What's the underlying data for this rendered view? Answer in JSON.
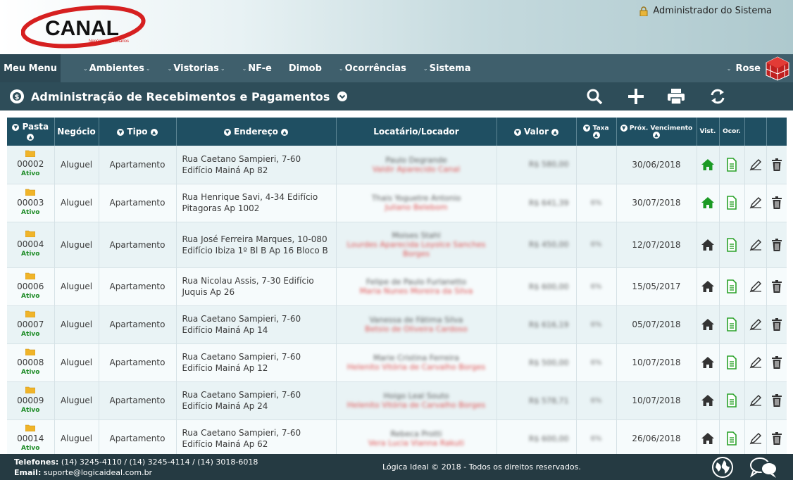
{
  "header": {
    "logo_text": "CANAL",
    "logo_subtitle": "Negócios Imobiliários",
    "admin_label": "Administrador do Sistema"
  },
  "nav": {
    "menu_label": "Meu Menu",
    "items": [
      {
        "label": "Ambientes"
      },
      {
        "label": "Vistorias"
      },
      {
        "label": "NF-e"
      },
      {
        "label": "Dimob"
      },
      {
        "label": "Ocorrências"
      },
      {
        "label": "Sistema"
      }
    ],
    "user_label": "Rose"
  },
  "page": {
    "title": "Administração de Recebimentos e Pagamentos"
  },
  "table": {
    "headers": {
      "pasta": "Pasta",
      "negocio": "Negócio",
      "tipo": "Tipo",
      "endereco": "Endereço",
      "locatario": "Locatário/Locador",
      "valor": "Valor",
      "taxa": "Taxa",
      "vencimento": "Próx. Vencimento",
      "vist": "Vist.",
      "ocor": "Ocor."
    },
    "rows": [
      {
        "pasta": "00002",
        "status": "Ativo",
        "negocio": "Aluguel",
        "tipo": "Apartamento",
        "endereco": "Rua Caetano Sampieri, 7-60 Edifício Mainá Ap 82",
        "locatario": "Paulo Degrande",
        "locador": "Valdir Aparecido Canal",
        "valor": "R$ 580,00",
        "taxa": "",
        "vencimento": "30/06/2018",
        "vist_active": true
      },
      {
        "pasta": "00003",
        "status": "Ativo",
        "negocio": "Aluguel",
        "tipo": "Apartamento",
        "endereco": "Rua Henrique Savi, 4-34 Edifício Pitagoras Ap 1002",
        "locatario": "Thais Yoguetre Antonio",
        "locador": "Juliano Belebom",
        "valor": "R$ 641,39",
        "taxa": "6%",
        "vencimento": "30/07/2018",
        "vist_active": true
      },
      {
        "pasta": "00004",
        "status": "Ativo",
        "negocio": "Aluguel",
        "tipo": "Apartamento",
        "endereco": "Rua José Ferreira Marques, 10-080 Edifício Ibiza 1º Bl B Ap 16 Bloco B",
        "locatario": "Moises Stahl",
        "locador": "Lourdes Aparecida Loyolce Sanches Borges",
        "valor": "R$ 450,00",
        "taxa": "6%",
        "vencimento": "12/07/2018",
        "vist_active": false
      },
      {
        "pasta": "00006",
        "status": "Ativo",
        "negocio": "Aluguel",
        "tipo": "Apartamento",
        "endereco": "Rua Nicolau Assis, 7-30 Edifício Juquis Ap 26",
        "locatario": "Felipe de Paulo Furlanetto",
        "locador": "Maria Nunes Moreira da Silva",
        "valor": "R$ 600,00",
        "taxa": "6%",
        "vencimento": "15/05/2017",
        "vist_active": false
      },
      {
        "pasta": "00007",
        "status": "Ativo",
        "negocio": "Aluguel",
        "tipo": "Apartamento",
        "endereco": "Rua Caetano Sampieri, 7-60 Edifício Mainá Ap 14",
        "locatario": "Vanessa de Fátima Silva",
        "locador": "Betsio de Oliveira Cardoso",
        "valor": "R$ 616,19",
        "taxa": "6%",
        "vencimento": "05/07/2018",
        "vist_active": false
      },
      {
        "pasta": "00008",
        "status": "Ativo",
        "negocio": "Aluguel",
        "tipo": "Apartamento",
        "endereco": "Rua Caetano Sampieri, 7-60 Edifício Mainá Ap 12",
        "locatario": "Marie Cristina Ferreira",
        "locador": "Helenito Vitória de Carvalho Borges",
        "valor": "R$ 500,00",
        "taxa": "6%",
        "vencimento": "10/07/2018",
        "vist_active": false
      },
      {
        "pasta": "00009",
        "status": "Ativo",
        "negocio": "Aluguel",
        "tipo": "Apartamento",
        "endereco": "Rua Caetano Sampieri, 7-60 Edifício Mainá Ap 24",
        "locatario": "Hoigo Leal Souto",
        "locador": "Helenito Vitória de Carvalho Borges",
        "valor": "R$ 578,71",
        "taxa": "6%",
        "vencimento": "10/07/2018",
        "vist_active": false
      },
      {
        "pasta": "00014",
        "status": "Ativo",
        "negocio": "Aluguel",
        "tipo": "Apartamento",
        "endereco": "Rua Caetano Sampieri, 7-60 Edifício Mainá Ap 62",
        "locatario": "Rebeca Protti",
        "locador": "Vera Lucia Vianna Rakuti",
        "valor": "R$ 600,00",
        "taxa": "6%",
        "vencimento": "26/06/2018",
        "vist_active": false
      }
    ]
  },
  "footer": {
    "phones_label": "Telefones:",
    "phones": "(14) 3245-4110 / (14) 3245-4114 / (14) 3018-6018",
    "email_label": "Email:",
    "email": "suporte@logicaideal.com.br",
    "copyright": "Lógica Ideal © 2018 - Todos os direitos reservados."
  },
  "colors": {
    "nav_bg": "#3f5f6c",
    "title_bg": "#2e4d59",
    "table_header_bg": "#1f4f62",
    "footer_bg": "#253a42",
    "active_green": "#1b8a24",
    "doc_green": "#2aa22a",
    "logo_red": "#d62020"
  },
  "icons": {
    "search": "search-icon",
    "add": "plus-icon",
    "print": "printer-icon",
    "refresh": "refresh-icon",
    "house": "house-icon",
    "document": "document-icon",
    "edit": "pencil-icon",
    "delete": "trash-icon"
  }
}
